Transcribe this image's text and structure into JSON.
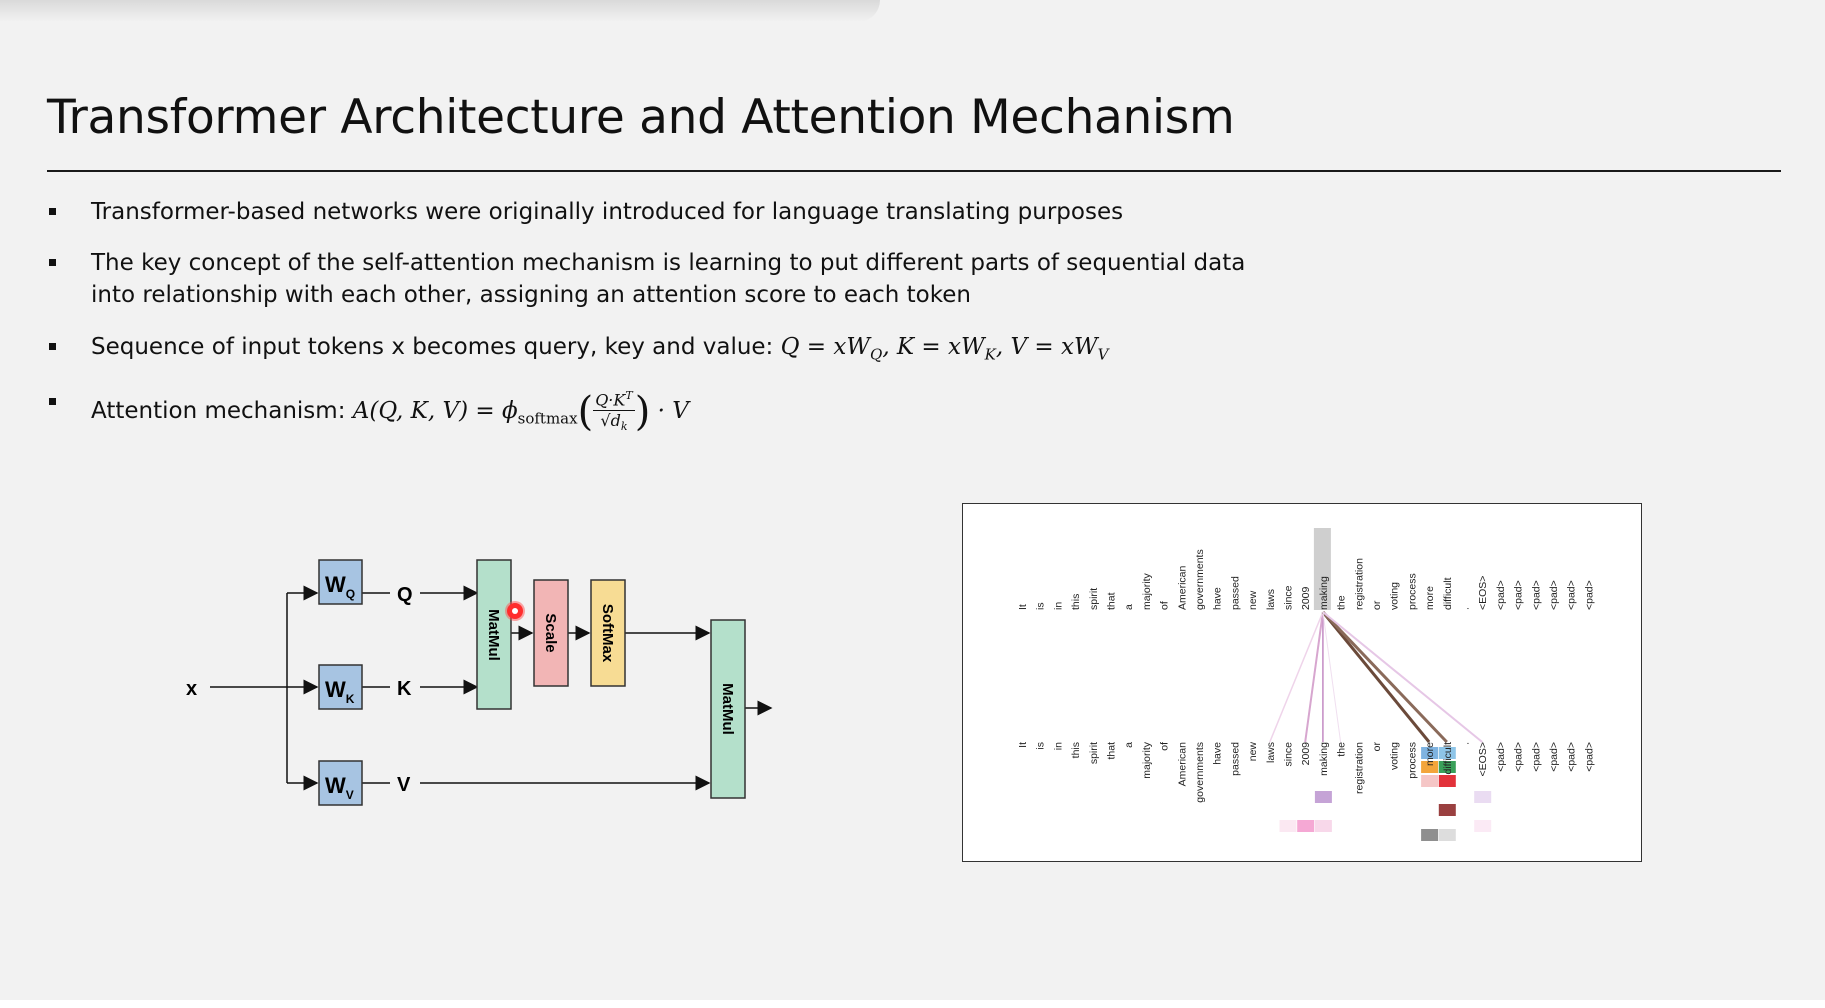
{
  "slide": {
    "title": "Transformer Architecture and Attention Mechanism",
    "bullets": [
      "Transformer-based networks were originally introduced for language translating purposes",
      "The key concept of the self-attention mechanism is learning to put different parts of sequential data into relationship with each other, assigning an attention score to each token"
    ],
    "bullet3_prefix": "Sequence of input tokens x becomes query, key and value:",
    "bullet4_prefix": "Attention mechanism:",
    "formula_qkv": {
      "q": "Q = xW",
      "q_sub": "Q",
      "k": ", K = xW",
      "k_sub": "K",
      "v": ", V = xW",
      "v_sub": "V"
    },
    "formula_attention": {
      "lhs": "A(Q, K, V) = ",
      "phi": "ϕ",
      "phi_sub": "softmax",
      "numerator": "Q·K",
      "numerator_sup": "T",
      "denominator": "√d",
      "denominator_sub": "k",
      "tail": "· V"
    }
  },
  "diagram": {
    "input_label": "x",
    "weights": [
      {
        "main": "W",
        "sub": "Q"
      },
      {
        "main": "W",
        "sub": "K"
      },
      {
        "main": "W",
        "sub": "V"
      }
    ],
    "outputs": [
      "Q",
      "K",
      "V"
    ],
    "blocks": {
      "matmul1": "MatMul",
      "scale": "Scale",
      "softmax": "SoftMax",
      "matmul2": "MatMul"
    },
    "colors": {
      "weight_box": "#a7c4e2",
      "matmul": "#b4e0cb",
      "scale": "#f2b5b5",
      "softmax": "#f7dc94"
    }
  },
  "attention_viz": {
    "top_tokens": [
      "It",
      "is",
      "in",
      "this",
      "spirit",
      "that",
      "a",
      "majority",
      "of",
      "American",
      "governments",
      "have",
      "passed",
      "new",
      "laws",
      "since",
      "2009",
      "making",
      "the",
      "registration",
      "or",
      "voting",
      "process",
      "more",
      "difficult",
      ".",
      "<EOS>",
      "<pad>",
      "<pad>",
      "<pad>",
      "<pad>",
      "<pad>",
      "<pad>"
    ],
    "bottom_tokens": [
      "It",
      "is",
      "in",
      "this",
      "spirit",
      "that",
      "a",
      "majority",
      "of",
      "American",
      "governments",
      "have",
      "passed",
      "new",
      "laws",
      "since",
      "2009",
      "making",
      "the",
      "registration",
      "or",
      "voting",
      "process",
      "more",
      "difficult",
      ".",
      "<EOS>",
      "<pad>",
      "<pad>",
      "<pad>",
      "<pad>",
      "<pad>",
      "<pad>"
    ],
    "highlight_token": "making",
    "highlight_color": "#cfcfcf"
  }
}
